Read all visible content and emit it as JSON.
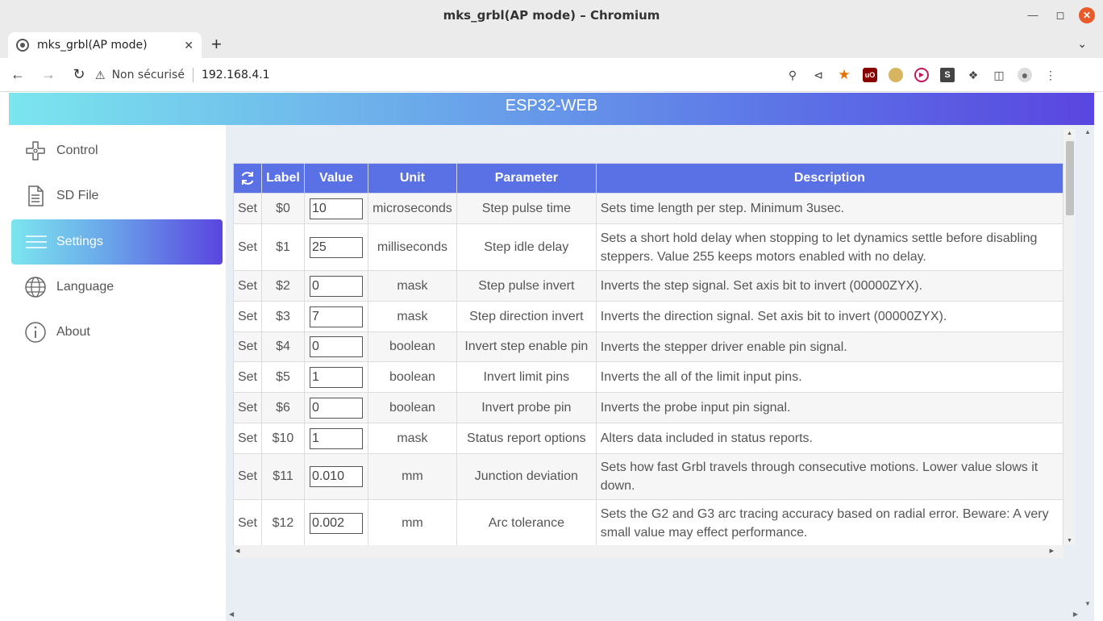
{
  "window": {
    "title": "mks_grbl(AP mode) – Chromium"
  },
  "tab": {
    "title": "mks_grbl(AP mode)"
  },
  "addressbar": {
    "security_label": "Non sécurisé",
    "url": "192.168.4.1"
  },
  "header": {
    "title": "ESP32-WEB"
  },
  "sidebar": {
    "items": [
      {
        "label": "Control",
        "icon": "gamepad-icon"
      },
      {
        "label": "SD File",
        "icon": "file-icon"
      },
      {
        "label": "Settings",
        "icon": "menu-icon",
        "active": true
      },
      {
        "label": "Language",
        "icon": "globe-icon"
      },
      {
        "label": "About",
        "icon": "info-icon"
      }
    ]
  },
  "table": {
    "columns": [
      "Label",
      "Value",
      "Unit",
      "Parameter",
      "Description"
    ],
    "set_label": "Set",
    "rows": [
      {
        "label": "$0",
        "value": "10",
        "unit": "microseconds",
        "parameter": "Step pulse time",
        "description": "Sets time length per step. Minimum 3usec."
      },
      {
        "label": "$1",
        "value": "25",
        "unit": "milliseconds",
        "parameter": "Step idle delay",
        "description": "Sets a short hold delay when stopping to let dynamics settle before disabling steppers. Value 255 keeps motors enabled with no delay."
      },
      {
        "label": "$2",
        "value": "0",
        "unit": "mask",
        "parameter": "Step pulse invert",
        "description": "Inverts the step signal. Set axis bit to invert (00000ZYX)."
      },
      {
        "label": "$3",
        "value": "7",
        "unit": "mask",
        "parameter": "Step direction invert",
        "description": "Inverts the direction signal. Set axis bit to invert (00000ZYX)."
      },
      {
        "label": "$4",
        "value": "0",
        "unit": "boolean",
        "parameter": "Invert step enable pin",
        "description": "Inverts the stepper driver enable pin signal."
      },
      {
        "label": "$5",
        "value": "1",
        "unit": "boolean",
        "parameter": "Invert limit pins",
        "description": "Inverts the all of the limit input pins."
      },
      {
        "label": "$6",
        "value": "0",
        "unit": "boolean",
        "parameter": "Invert probe pin",
        "description": "Inverts the probe input pin signal."
      },
      {
        "label": "$10",
        "value": "1",
        "unit": "mask",
        "parameter": "Status report options",
        "description": "Alters data included in status reports."
      },
      {
        "label": "$11",
        "value": "0.010",
        "unit": "mm",
        "parameter": "Junction deviation",
        "description": "Sets how fast Grbl travels through consecutive motions. Lower value slows it down."
      },
      {
        "label": "$12",
        "value": "0.002",
        "unit": "mm",
        "parameter": "Arc tolerance",
        "description": "Sets the G2 and G3 arc tracing accuracy based on radial error. Beware: A very small value may effect performance."
      }
    ]
  }
}
